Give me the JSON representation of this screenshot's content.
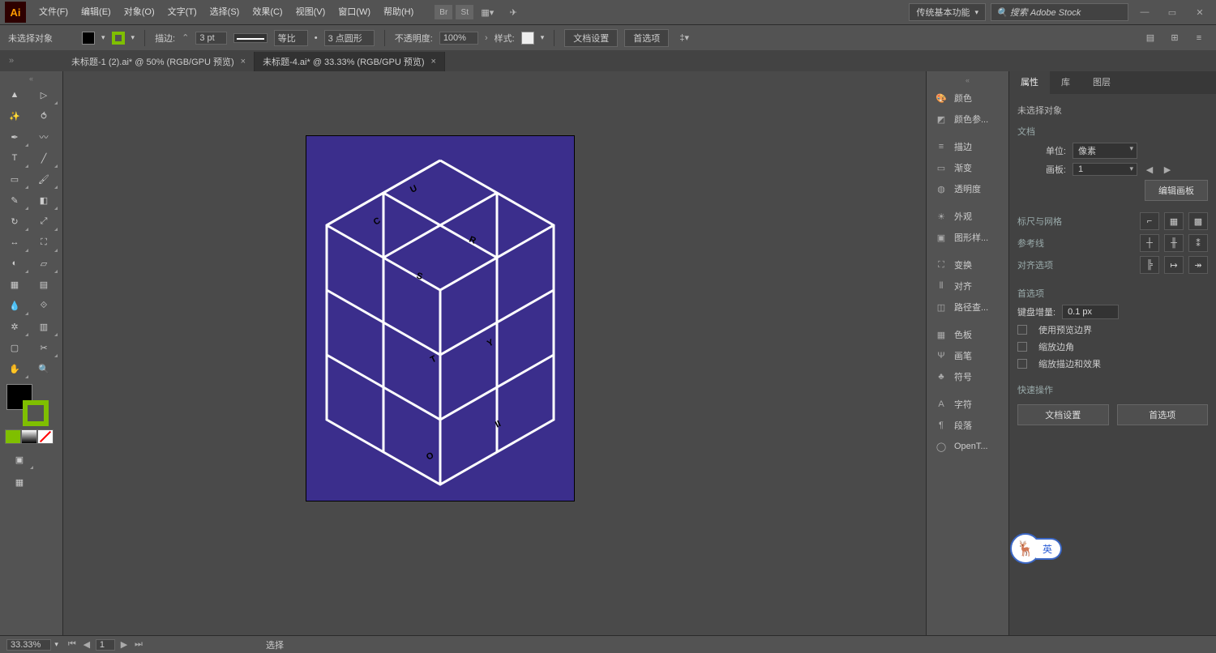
{
  "app_logo": "Ai",
  "menus": [
    "文件(F)",
    "编辑(E)",
    "对象(O)",
    "文字(T)",
    "选择(S)",
    "效果(C)",
    "视图(V)",
    "窗口(W)",
    "帮助(H)"
  ],
  "top_icons": [
    "Br",
    "St"
  ],
  "workspace": "传统基本功能",
  "search_placeholder": "搜索 Adobe Stock",
  "selection_label": "未选择对象",
  "stroke_label": "描边:",
  "stroke_weight": "3 pt",
  "stroke_profile": "等比",
  "stroke_dash": "3 点圆形",
  "opacity_label": "不透明度:",
  "opacity_value": "100%",
  "style_label": "样式:",
  "docsetup_btn": "文档设置",
  "prefs_btn": "首选项",
  "tabs": [
    {
      "label": "未标题-1 (2).ai* @ 50% (RGB/GPU 预览)",
      "active": false
    },
    {
      "label": "未标题-4.ai* @ 33.33% (RGB/GPU 预览)",
      "active": true
    }
  ],
  "dock_groups": [
    [
      "颜色",
      "颜色参..."
    ],
    [
      "描边",
      "渐变",
      "透明度"
    ],
    [
      "外观",
      "图形样..."
    ],
    [
      "变换",
      "对齐",
      "路径查..."
    ],
    [
      "色板",
      "画笔",
      "符号"
    ],
    [
      "字符",
      "段落",
      "OpenT..."
    ]
  ],
  "rpanel": {
    "tabs": [
      "属性",
      "库",
      "图层"
    ],
    "no_sel": "未选择对象",
    "doc_head": "文档",
    "unit_lbl": "单位:",
    "unit_val": "像素",
    "artboard_lbl": "画板:",
    "artboard_val": "1",
    "edit_artboard": "编辑画板",
    "ruler_head": "标尺与网格",
    "guides_head": "参考线",
    "align_head": "对齐选项",
    "prefs_head": "首选项",
    "key_inc_lbl": "键盘增量:",
    "key_inc_val": "0.1 px",
    "chk1": "使用预览边界",
    "chk2": "缩放边角",
    "chk3": "缩放描边和效果",
    "quick_head": "快速操作",
    "qa1": "文档设置",
    "qa2": "首选项"
  },
  "ime": "英",
  "status": {
    "zoom": "33.33%",
    "artboard": "1",
    "tool": "选择"
  }
}
